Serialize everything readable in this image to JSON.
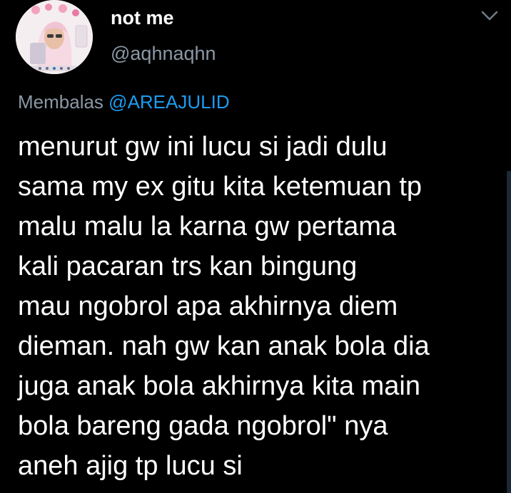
{
  "user": {
    "display_name": "not me",
    "handle": "@aqhnaqhn",
    "avatar_icon": "profile-photo"
  },
  "reply": {
    "prefix": "Membalas",
    "mention": "@AREAJULID"
  },
  "tweet": {
    "lines": [
      "menurut gw ini lucu si jadi dulu",
      "sama my ex gitu kita ketemuan tp",
      "malu malu la karna gw pertama",
      "kali pacaran trs kan bingung",
      "mau ngobrol apa akhirnya diem",
      "dieman. nah gw kan anak bola dia",
      "juga anak bola akhirnya kita main",
      "bola bareng gada ngobrol\" nya",
      "aneh ajig tp lucu si"
    ]
  },
  "icons": {
    "menu": "chevron-down-icon"
  },
  "colors": {
    "background": "#000000",
    "text": "#ffffff",
    "secondary_text": "#8b98a5",
    "accent": "#1d9bf0"
  }
}
